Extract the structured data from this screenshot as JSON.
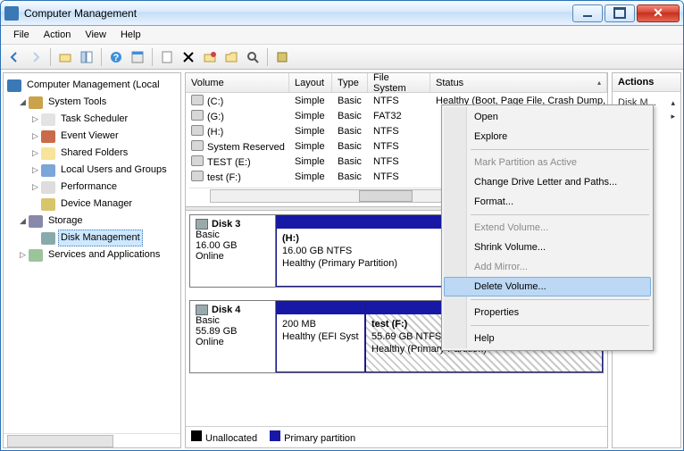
{
  "window": {
    "title": "Computer Management"
  },
  "menubar": {
    "file": "File",
    "action": "Action",
    "view": "View",
    "help": "Help"
  },
  "toolbar_icons": [
    "back",
    "forward",
    "up",
    "show-hide-console-tree",
    "help",
    "properties",
    "refresh",
    "export-list",
    "delete",
    "settings",
    "action",
    "find",
    "script"
  ],
  "tree": {
    "root": "Computer Management (Local",
    "system_tools": "System Tools",
    "task_scheduler": "Task Scheduler",
    "event_viewer": "Event Viewer",
    "shared_folders": "Shared Folders",
    "local_users": "Local Users and Groups",
    "performance": "Performance",
    "device_manager": "Device Manager",
    "storage": "Storage",
    "disk_management": "Disk Management",
    "services_apps": "Services and Applications"
  },
  "columns": {
    "volume": "Volume",
    "layout": "Layout",
    "type": "Type",
    "fs": "File System",
    "status": "Status"
  },
  "volumes": [
    {
      "name": "(C:)",
      "layout": "Simple",
      "type": "Basic",
      "fs": "NTFS",
      "status": "Healthy (Boot, Page File, Crash Dump, Primary Partition)"
    },
    {
      "name": "(G:)",
      "layout": "Simple",
      "type": "Basic",
      "fs": "FAT32",
      "status": ""
    },
    {
      "name": "(H:)",
      "layout": "Simple",
      "type": "Basic",
      "fs": "NTFS",
      "status": ""
    },
    {
      "name": "System Reserved",
      "layout": "Simple",
      "type": "Basic",
      "fs": "NTFS",
      "status": ""
    },
    {
      "name": "TEST (E:)",
      "layout": "Simple",
      "type": "Basic",
      "fs": "NTFS",
      "status": ""
    },
    {
      "name": "test (F:)",
      "layout": "Simple",
      "type": "Basic",
      "fs": "NTFS",
      "status": ""
    }
  ],
  "disks": [
    {
      "name": "Disk 3",
      "type": "Basic",
      "size": "16.00 GB",
      "status": "Online",
      "partitions": [
        {
          "label": "(H:)",
          "line2": "16.00 GB NTFS",
          "line3": "Healthy (Primary Partition)",
          "hatched": false
        }
      ]
    },
    {
      "name": "Disk 4",
      "type": "Basic",
      "size": "55.89 GB",
      "status": "Online",
      "partitions": [
        {
          "label": "",
          "line2": "200 MB",
          "line3": "Healthy (EFI Syst",
          "hatched": false
        },
        {
          "label": "test  (F:)",
          "line2": "55.69 GB NTFS",
          "line3": "Healthy (Primary Partition)",
          "hatched": true
        }
      ]
    }
  ],
  "legend": {
    "unallocated": "Unallocated",
    "primary": "Primary partition"
  },
  "actions": {
    "header": "Actions",
    "item1": "Disk M..."
  },
  "context_menu": {
    "open": "Open",
    "explore": "Explore",
    "mark_active": "Mark Partition as Active",
    "change_letter": "Change Drive Letter and Paths...",
    "format": "Format...",
    "extend": "Extend Volume...",
    "shrink": "Shrink Volume...",
    "add_mirror": "Add Mirror...",
    "delete": "Delete Volume...",
    "properties": "Properties",
    "help": "Help"
  }
}
